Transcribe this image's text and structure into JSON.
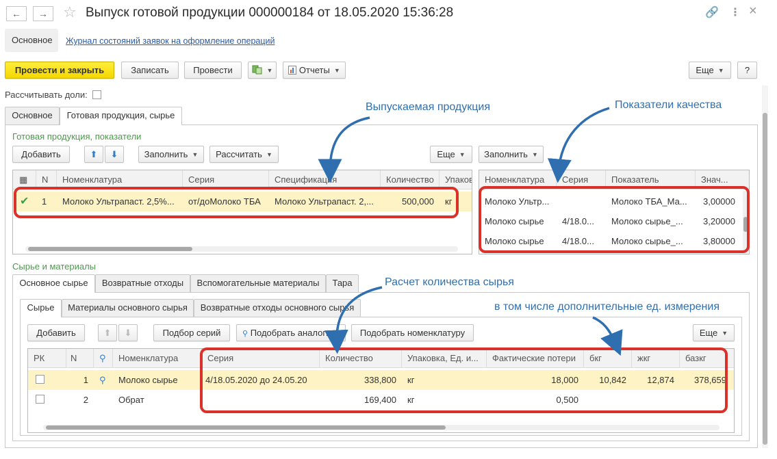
{
  "window": {
    "title": "Выпуск готовой продукции 000000184 от 18.05.2020 15:36:28",
    "back_icon": "←",
    "forward_icon": "→",
    "star_icon": "☆",
    "link_icon": "🔗",
    "menu_icon": "⋮",
    "close_icon": "×"
  },
  "nav": {
    "main": "Основное",
    "link": "Журнал состояний заявок на оформление операций"
  },
  "toolbar": {
    "post_close": "Провести и закрыть",
    "save": "Записать",
    "post": "Провести",
    "reports": "Отчеты",
    "more": "Еще",
    "help": "?"
  },
  "share_label": "Рассчитывать доли:",
  "tabs": [
    "Основное",
    "Готовая продукция, сырье"
  ],
  "products": {
    "group": "Готовая продукция, показатели",
    "add": "Добавить",
    "fill": "Заполнить",
    "calc": "Рассчитать",
    "more": "Еще",
    "headers": [
      "N",
      "Номенклатура",
      "Серия",
      "Спецификация",
      "Количество",
      "Упаков"
    ],
    "rows": [
      {
        "n": "1",
        "nom": "Молоко Ультрапаст. 2,5%...",
        "series": "от/доМолоко ТБА",
        "spec": "Молоко Ультрапаст. 2,...",
        "qty": "500,000",
        "unit": "кг"
      }
    ]
  },
  "quality": {
    "fill": "Заполнить",
    "headers": [
      "Номенклатура",
      "Серия",
      "Показатель",
      "Знач..."
    ],
    "rows": [
      {
        "nom": "Молоко Ультр...",
        "series": "",
        "ind": "Молоко ТБА_Ма...",
        "val": "3,00000"
      },
      {
        "nom": "Молоко сырье",
        "series": "4/18.0...",
        "ind": "Молоко сырье_...",
        "val": "3,20000"
      },
      {
        "nom": "Молоко сырье",
        "series": "4/18.0...",
        "ind": "Молоко сырье_...",
        "val": "3,80000"
      }
    ]
  },
  "materials": {
    "group": "Сырье и материалы",
    "tabs": [
      "Основное сырье",
      "Возвратные отходы",
      "Вспомогательные материалы",
      "Тара"
    ],
    "subtabs": [
      "Сырье",
      "Материалы основного сырья",
      "Возвратные отходы основного сырья"
    ],
    "add": "Добавить",
    "pick_series": "Подбор серий",
    "pick_analogs": "Подобрать аналоги",
    "pick_nom": "Подобрать номенклатуру",
    "more": "Еще",
    "headers": [
      "РК",
      "N",
      "Номенклатура",
      "Серия",
      "Количество",
      "Упаковка, Ед. и...",
      "Фактические потери",
      "бкг",
      "жкг",
      "базкг"
    ],
    "rows": [
      {
        "n": "1",
        "nom": "Молоко сырье",
        "series": "4/18.05.2020 до 24.05.20",
        "qty": "338,800",
        "unit": "кг",
        "loss": "18,000",
        "bkg": "10,842",
        "zhkg": "12,874",
        "bazkg": "378,659"
      },
      {
        "n": "2",
        "nom": "Обрат",
        "series": "",
        "qty": "169,400",
        "unit": "кг",
        "loss": "0,500",
        "bkg": "",
        "zhkg": "",
        "bazkg": ""
      }
    ]
  },
  "annotations": {
    "a1": "Выпускаемая продукция",
    "a2": "Показатели качества",
    "a3": "Расчет количества сырья",
    "a4": "в том числе дополнительные ед. измерения"
  },
  "colors": {
    "primary": "#f5d800",
    "selected_row": "#fdf3c4",
    "annotation": "#2f6fb0",
    "highlight": "#d9322b",
    "group_label": "#4a9a4a"
  }
}
